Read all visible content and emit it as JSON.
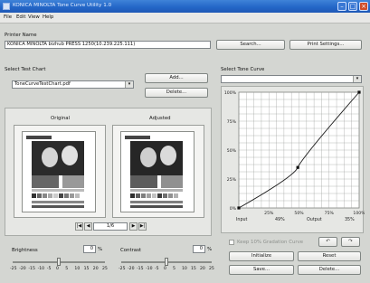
{
  "window": {
    "title": "KONICA MINOLTA Tone Curve Utility 1.0"
  },
  "menu": [
    "File",
    "Edit",
    "View",
    "Help"
  ],
  "printer": {
    "label": "Printer Name",
    "value": "KONICA MINOLTA bizhub PRESS 1250(10.239.225.111)",
    "search": "Search...",
    "print_settings": "Print Settings..."
  },
  "test_chart": {
    "label": "Select Test Chart",
    "value": "ToneCurveTestChart.pdf",
    "add": "Add...",
    "delete": "Delete..."
  },
  "preview": {
    "original": "Original",
    "adjusted": "Adjusted",
    "page": "1/6"
  },
  "brightness": {
    "label": "Brightness",
    "value": "0",
    "unit": "%",
    "level": 0
  },
  "contrast": {
    "label": "Contrast",
    "value": "0",
    "unit": "%",
    "level": 0
  },
  "slider_scale": [
    "-25",
    "-20",
    "-15",
    "-10",
    "-5",
    "0",
    "5",
    "10",
    "15",
    "20",
    "25"
  ],
  "tone_curve": {
    "label": "Select Tone Curve",
    "selected": "",
    "y_ticks": [
      "100%",
      "75%",
      "50%",
      "25%",
      "0%"
    ],
    "x_ticks": [
      "25%",
      "50%",
      "75%",
      "100%"
    ],
    "input_label": "Input",
    "input_value": "49%",
    "output_label": "Output",
    "output_value": "35%",
    "keep_label": "Keep 10% Gradation Curve",
    "undo": "↶",
    "redo": "↷",
    "initialize": "Initialize",
    "reset": "Reset",
    "save": "Save...",
    "delete": "Delete..."
  },
  "chart_data": {
    "type": "line",
    "x": [
      0,
      49,
      100
    ],
    "y": [
      0,
      35,
      100
    ],
    "xlim": [
      0,
      100
    ],
    "ylim": [
      0,
      100
    ],
    "grid": true
  }
}
